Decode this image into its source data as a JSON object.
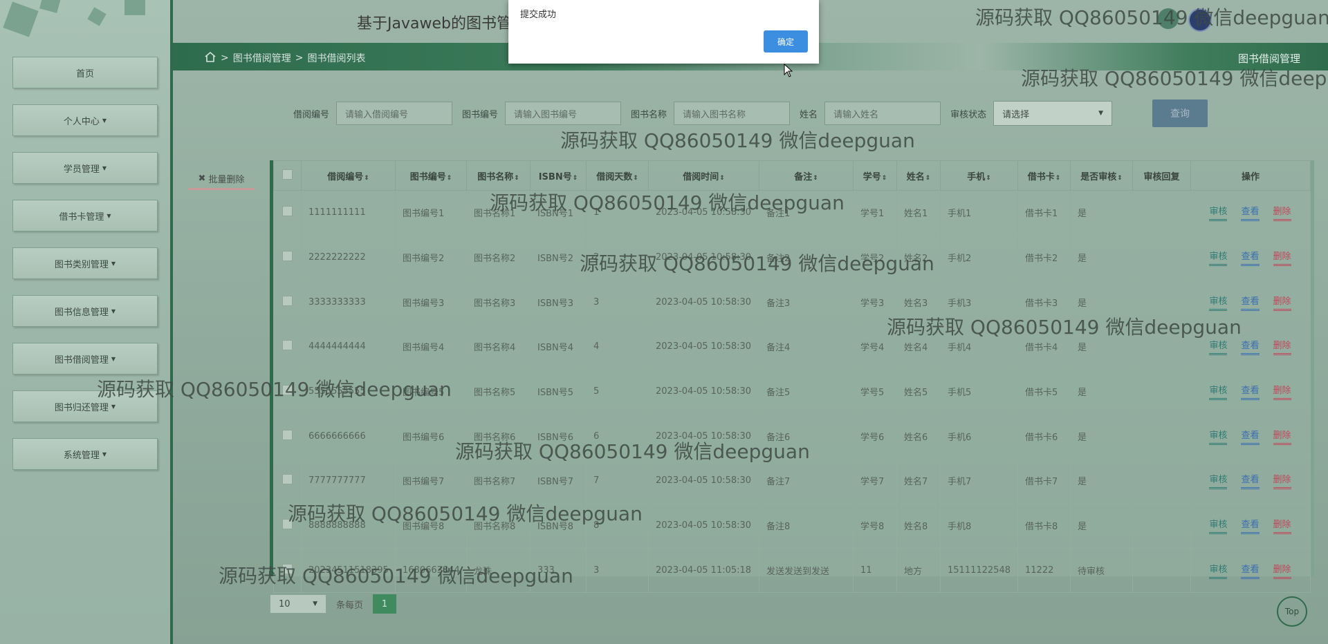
{
  "app": {
    "title": "基于Javaweb的图书管"
  },
  "sidebar": {
    "items": [
      {
        "label": "首页",
        "caret": false
      },
      {
        "label": "个人中心",
        "caret": true
      },
      {
        "label": "学员管理",
        "caret": true
      },
      {
        "label": "借书卡管理",
        "caret": true
      },
      {
        "label": "图书类别管理",
        "caret": true
      },
      {
        "label": "图书信息管理",
        "caret": true
      },
      {
        "label": "图书借阅管理",
        "caret": true
      },
      {
        "label": "图书归还管理",
        "caret": true
      },
      {
        "label": "系统管理",
        "caret": true
      }
    ]
  },
  "breadcrumb": {
    "sep": ">",
    "items": [
      "图书借阅管理",
      "图书借阅列表"
    ]
  },
  "page_label": "图书借阅管理",
  "search": {
    "fields": [
      {
        "label": "借阅编号",
        "placeholder": "请输入借阅编号"
      },
      {
        "label": "图书编号",
        "placeholder": "请输入图书编号"
      },
      {
        "label": "图书名称",
        "placeholder": "请输入图书名称"
      },
      {
        "label": "姓名",
        "placeholder": "请输入姓名"
      }
    ],
    "status_label": "审核状态",
    "status_value": "请选择",
    "button": "查询"
  },
  "batch_delete": "批量删除",
  "table": {
    "headers": [
      "借阅编号",
      "图书编号",
      "图书名称",
      "ISBN号",
      "借阅天数",
      "借阅时间",
      "备注",
      "学号",
      "姓名",
      "手机",
      "借书卡",
      "是否审核",
      "审核回复",
      "操作"
    ],
    "rows": [
      [
        "1111111111",
        "图书编号1",
        "图书名称1",
        "ISBN号1",
        "1",
        "2023-04-05 10:58:30",
        "备注1",
        "学号1",
        "姓名1",
        "手机1",
        "借书卡1",
        "是",
        ""
      ],
      [
        "2222222222",
        "图书编号2",
        "图书名称2",
        "ISBN号2",
        "2",
        "2023-04-05 10:58:30",
        "备注2",
        "学号2",
        "姓名2",
        "手机2",
        "借书卡2",
        "是",
        ""
      ],
      [
        "3333333333",
        "图书编号3",
        "图书名称3",
        "ISBN号3",
        "3",
        "2023-04-05 10:58:30",
        "备注3",
        "学号3",
        "姓名3",
        "手机3",
        "借书卡3",
        "是",
        ""
      ],
      [
        "4444444444",
        "图书编号4",
        "图书名称4",
        "ISBN号4",
        "4",
        "2023-04-05 10:58:30",
        "备注4",
        "学号4",
        "姓名4",
        "手机4",
        "借书卡4",
        "是",
        ""
      ],
      [
        "5555555555",
        "图书编号5",
        "图书名称5",
        "ISBN号5",
        "5",
        "2023-04-05 10:58:30",
        "备注5",
        "学号5",
        "姓名5",
        "手机5",
        "借书卡5",
        "是",
        ""
      ],
      [
        "6666666666",
        "图书编号6",
        "图书名称6",
        "ISBN号6",
        "6",
        "2023-04-05 10:58:30",
        "备注6",
        "学号6",
        "姓名6",
        "手机6",
        "借书卡6",
        "是",
        ""
      ],
      [
        "7777777777",
        "图书编号7",
        "图书名称7",
        "ISBN号7",
        "7",
        "2023-04-05 10:58:30",
        "备注7",
        "学号7",
        "姓名7",
        "手机7",
        "借书卡7",
        "是",
        ""
      ],
      [
        "8888888888",
        "图书编号8",
        "图书名称8",
        "ISBN号8",
        "8",
        "2023-04-05 10:58:30",
        "备注8",
        "学号8",
        "姓名8",
        "手机8",
        "借书卡8",
        "是",
        ""
      ],
      [
        "20234511518395",
        "1680663844",
        "龙珠",
        "333",
        "3",
        "2023-04-05 11:05:18",
        "发送发送到发送",
        "11",
        "地方",
        "15111122548",
        "11222",
        "待审核",
        ""
      ]
    ],
    "actions": {
      "audit": "审核",
      "view": "查看",
      "delete": "删除"
    }
  },
  "pager": {
    "per_page": "10",
    "per_page_label": "条每页",
    "current": "1"
  },
  "top_button": "Top",
  "dialog": {
    "message": "提交成功",
    "ok": "确定"
  },
  "watermark": "源码获取 QQ86050149 微信deepguan"
}
